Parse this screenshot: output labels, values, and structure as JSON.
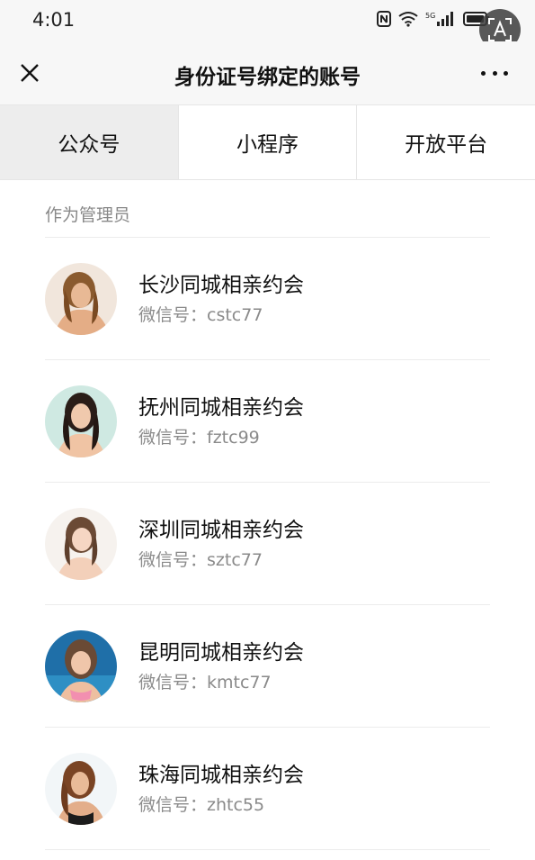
{
  "status_bar": {
    "time": "4:01",
    "network_label": "5G"
  },
  "nav": {
    "title": "身份证号绑定的账号"
  },
  "tabs": [
    {
      "label": "公众号",
      "active": true
    },
    {
      "label": "小程序",
      "active": false
    },
    {
      "label": "开放平台",
      "active": false
    }
  ],
  "section": {
    "label": "作为管理员"
  },
  "accounts": [
    {
      "name": "长沙同城相亲约会",
      "id_prefix": "微信号：",
      "id": "cstc77"
    },
    {
      "name": "抚州同城相亲约会",
      "id_prefix": "微信号：",
      "id": "fztc99"
    },
    {
      "name": "深圳同城相亲约会",
      "id_prefix": "微信号：",
      "id": "sztc77"
    },
    {
      "name": "昆明同城相亲约会",
      "id_prefix": "微信号：",
      "id": "kmtc77"
    },
    {
      "name": "珠海同城相亲约会",
      "id_prefix": "微信号：",
      "id": "zhtc55"
    }
  ],
  "colors": {
    "header_bg": "#f7f7f7",
    "active_tab_bg": "#ededed",
    "secondary_text": "#8a8a8a"
  }
}
